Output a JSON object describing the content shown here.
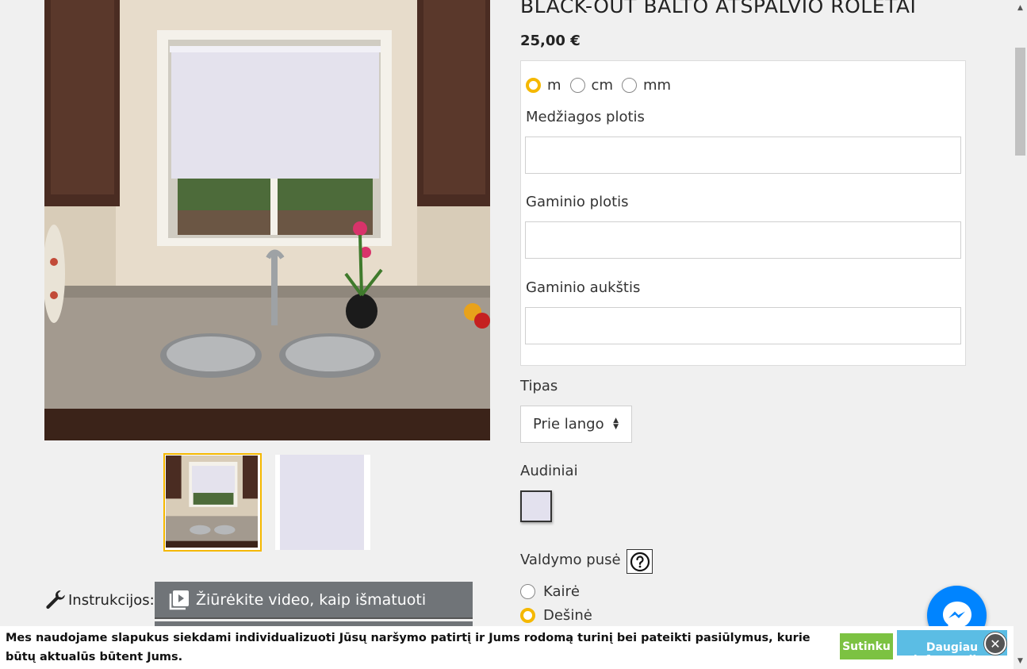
{
  "product": {
    "title": "BLACK-OUT BALTO ATSPALVIO ROLETAI",
    "price": "25,00 €"
  },
  "units": {
    "options": [
      "m",
      "cm",
      "mm"
    ],
    "selected": "m"
  },
  "fields": {
    "fabric_width_label": "Medžiagos plotis",
    "product_width_label": "Gaminio plotis",
    "product_height_label": "Gaminio aukštis"
  },
  "type": {
    "label": "Tipas",
    "selected": "Prie lango"
  },
  "fabrics": {
    "label": "Audiniai",
    "swatch_color": "#e3e1ee"
  },
  "control_side": {
    "label": "Valdymo pusė",
    "options": [
      "Kairė",
      "Dešinė"
    ],
    "selected": "Dešinė"
  },
  "instructions": {
    "label": "Instrukcijos:",
    "video_button": "Žiūrėkite video, kaip išmatuoti"
  },
  "cookie": {
    "text": "Mes naudojame slapukus siekdami individualizuoti Jūsų naršymo patirtį ir Jums rodomą turinį bei pateikti pasiūlymus, kurie būtų aktualūs būtent Jums.",
    "agree_button": "Sutinku",
    "more_button": "Daugiau informacijos"
  },
  "colors": {
    "accent": "#f5b800",
    "video_button_bg": "#707478",
    "agree_bg": "#7cc242",
    "more_bg": "#5bbde4",
    "messenger": "#0084ff"
  },
  "icons": {
    "instructions": "wrench-icon",
    "video": "play-list-icon",
    "help": "question-icon",
    "messenger": "messenger-icon",
    "close": "close-icon"
  }
}
